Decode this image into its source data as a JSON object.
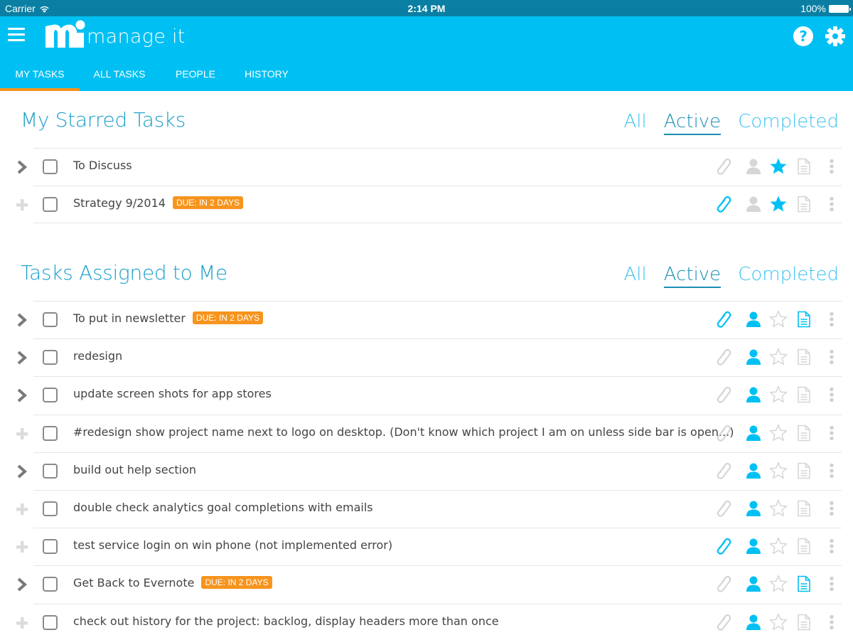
{
  "status_bar": {
    "carrier": "Carrier",
    "time": "2:14 PM",
    "battery": "100%"
  },
  "app": {
    "name": "manage it",
    "menu_icon": "hamburger-menu-icon",
    "help_icon": "help-icon",
    "help_glyph": "?",
    "settings_icon": "gear-icon"
  },
  "tabs": [
    {
      "label": "MY TASKS",
      "active": true
    },
    {
      "label": "ALL TASKS",
      "active": false
    },
    {
      "label": "PEOPLE",
      "active": false
    },
    {
      "label": "HISTORY",
      "active": false
    }
  ],
  "colors": {
    "brand": "#00c0f3",
    "status_bar": "#0a7fa3",
    "tab_indicator": "#f7941d",
    "badge": "#f7941d",
    "icon_active": "#00c0f3",
    "icon_inactive": "#d6d6d6",
    "heading": "#1a9fc9"
  },
  "sections": [
    {
      "title": "My Starred Tasks",
      "filters": [
        {
          "label": "All",
          "active": false
        },
        {
          "label": "Active",
          "active": true
        },
        {
          "label": "Completed",
          "active": false
        }
      ],
      "tasks": [
        {
          "title": "To Discuss",
          "badge": null,
          "expand": "chevron",
          "attachment": false,
          "assigned": false,
          "starred": true,
          "note": false
        },
        {
          "title": "Strategy 9/2014",
          "badge": "DUE: IN 2 DAYS",
          "expand": "plus",
          "attachment": true,
          "assigned": false,
          "starred": true,
          "note": false
        }
      ]
    },
    {
      "title": "Tasks Assigned to Me",
      "filters": [
        {
          "label": "All",
          "active": false
        },
        {
          "label": "Active",
          "active": true
        },
        {
          "label": "Completed",
          "active": false
        }
      ],
      "tasks": [
        {
          "title": "To put in newsletter",
          "badge": "DUE: IN 2 DAYS",
          "expand": "chevron",
          "attachment": true,
          "assigned": true,
          "starred": false,
          "note": true
        },
        {
          "title": "redesign",
          "badge": null,
          "expand": "chevron",
          "attachment": false,
          "assigned": true,
          "starred": false,
          "note": false
        },
        {
          "title": "update screen shots for app stores",
          "badge": null,
          "expand": "chevron",
          "attachment": false,
          "assigned": true,
          "starred": false,
          "note": false
        },
        {
          "title": "#redesign show project name next to logo on desktop. (Don't know which project I am on unless side bar is open...)",
          "badge": null,
          "expand": "plus",
          "attachment": false,
          "assigned": true,
          "starred": false,
          "note": false
        },
        {
          "title": "build out help section",
          "badge": null,
          "expand": "chevron",
          "attachment": false,
          "assigned": true,
          "starred": false,
          "note": false
        },
        {
          "title": "double check analytics goal completions with emails",
          "badge": null,
          "expand": "plus",
          "attachment": false,
          "assigned": true,
          "starred": false,
          "note": false
        },
        {
          "title": "test service login on win phone (not implemented error)",
          "badge": null,
          "expand": "plus",
          "attachment": true,
          "assigned": true,
          "starred": false,
          "note": false
        },
        {
          "title": "Get Back to Evernote",
          "badge": "DUE: IN 2 DAYS",
          "expand": "chevron",
          "attachment": false,
          "assigned": true,
          "starred": false,
          "note": true
        },
        {
          "title": "check out history for the project: backlog, display headers more than once",
          "badge": null,
          "expand": "plus",
          "attachment": false,
          "assigned": true,
          "starred": false,
          "note": false
        }
      ]
    }
  ]
}
